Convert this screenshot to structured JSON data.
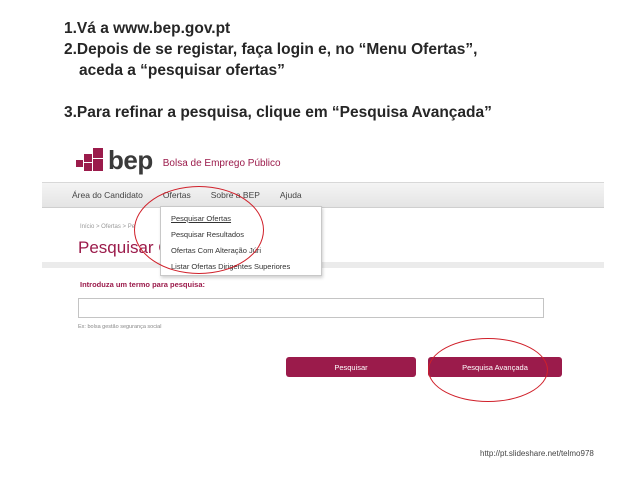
{
  "instructions": {
    "step1": "1.Vá a www.bep.gov.pt",
    "step2_line1": "2.Depois de se registar, faça login e, no “Menu Ofertas”,",
    "step2_line2": "aceda a “pesquisar ofertas”",
    "step3": "3.Para refinar a pesquisa, clique em “Pesquisa Avançada”"
  },
  "site": {
    "logo_text": "bep",
    "logo_subtitle": "Bolsa de Emprego Público",
    "brand_color": "#9b1b4b",
    "nav": [
      "Área do Candidato",
      "Ofertas",
      "Sobre a BEP",
      "Ajuda"
    ],
    "breadcrumb": "Início > Ofertas > Pe",
    "page_title": "Pesquisar O",
    "dropdown": [
      "Pesquisar Ofertas",
      "Pesquisar Resultados",
      "Ofertas Com Alteração Júri",
      "Listar Ofertas Dirigentes Superiores"
    ],
    "search_label": "Introduza um termo para pesquisa:",
    "search_value": "",
    "search_hint": "Ex: bolsa gestão segurança social",
    "btn_search": "Pesquisar",
    "btn_advanced": "Pesquisa Avançada"
  },
  "annotation_color": "#d0202a",
  "source": "http://pt.slideshare.net/telmo978"
}
